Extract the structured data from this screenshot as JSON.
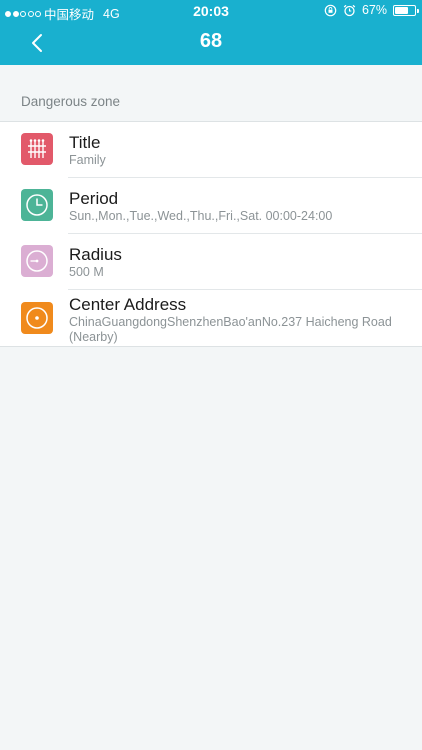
{
  "status_bar": {
    "carrier": "中国移动",
    "network": "4G",
    "time": "20:03",
    "battery": "67%",
    "battery_level": 0.67
  },
  "header": {
    "title": "68"
  },
  "section": {
    "label": "Dangerous zone"
  },
  "items": [
    {
      "title": "Title",
      "subtitle": "Family",
      "icon": "grid-icon",
      "color": "#e2596a"
    },
    {
      "title": "Period",
      "subtitle": "Sun.,Mon.,Tue.,Wed.,Thu.,Fri.,Sat.   00:00-24:00",
      "icon": "clock-icon",
      "color": "#4db497"
    },
    {
      "title": "Radius",
      "subtitle": "500 M",
      "icon": "radius-icon",
      "color": "#dbaed3"
    },
    {
      "title": "Center Address",
      "subtitle": "ChinaGuangdongShenzhenBao'anNo.237 Haicheng Road (Nearby)",
      "icon": "target-icon",
      "color": "#f08a1c"
    }
  ],
  "colors": {
    "header": "#19b0cf",
    "background": "#f3f6f7"
  }
}
